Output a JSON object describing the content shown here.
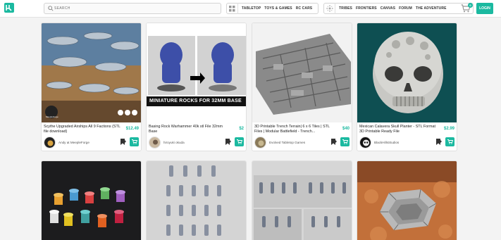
{
  "header": {
    "logo_icon": "logo-icon",
    "search_placeholder": "SEARCH",
    "nav_group_1": [
      "TABLETOP",
      "TOYS & GAMES",
      "RC CARS"
    ],
    "nav_group_2": [
      "TRIBES",
      "FRONTIERS",
      "CANVAS",
      "FORUM",
      "THE ADVENTURE"
    ],
    "cart_count": "0",
    "login_label": "LOGIN",
    "accent_color": "#1bb9a0"
  },
  "products": [
    {
      "title": "Scythe Upgraded Airships All 9 Factions (STL file download)",
      "price": "$12.49",
      "author": "Andy at MeepleForge",
      "image_label": "MeepleForge"
    },
    {
      "title": "Basing Rock Warhammer 40k stl File 32mm Base",
      "price": "$2",
      "author": "hiroyuki okuda",
      "image_label": "MINIATURE ROCKS FOR 32MM BASE"
    },
    {
      "title": "3D Printable Trench Terrain| 6 x 6 Tiles | STL Files | Modular Battlefield - Trench...",
      "price": "$40",
      "author": "Evolved Tabletop Games",
      "image_label": ""
    },
    {
      "title": "Mexican Calavera Skull Planter - STL Format 3D Printable Ready File",
      "price": "$2.99",
      "author": "BlackHillsStudios",
      "image_label": ""
    },
    {
      "title": "",
      "price": "",
      "author": "",
      "image_label": ""
    },
    {
      "title": "",
      "price": "",
      "author": "",
      "image_label": ""
    },
    {
      "title": "",
      "price": "",
      "author": "",
      "image_label": ""
    },
    {
      "title": "",
      "price": "",
      "author": "",
      "image_label": ""
    }
  ]
}
